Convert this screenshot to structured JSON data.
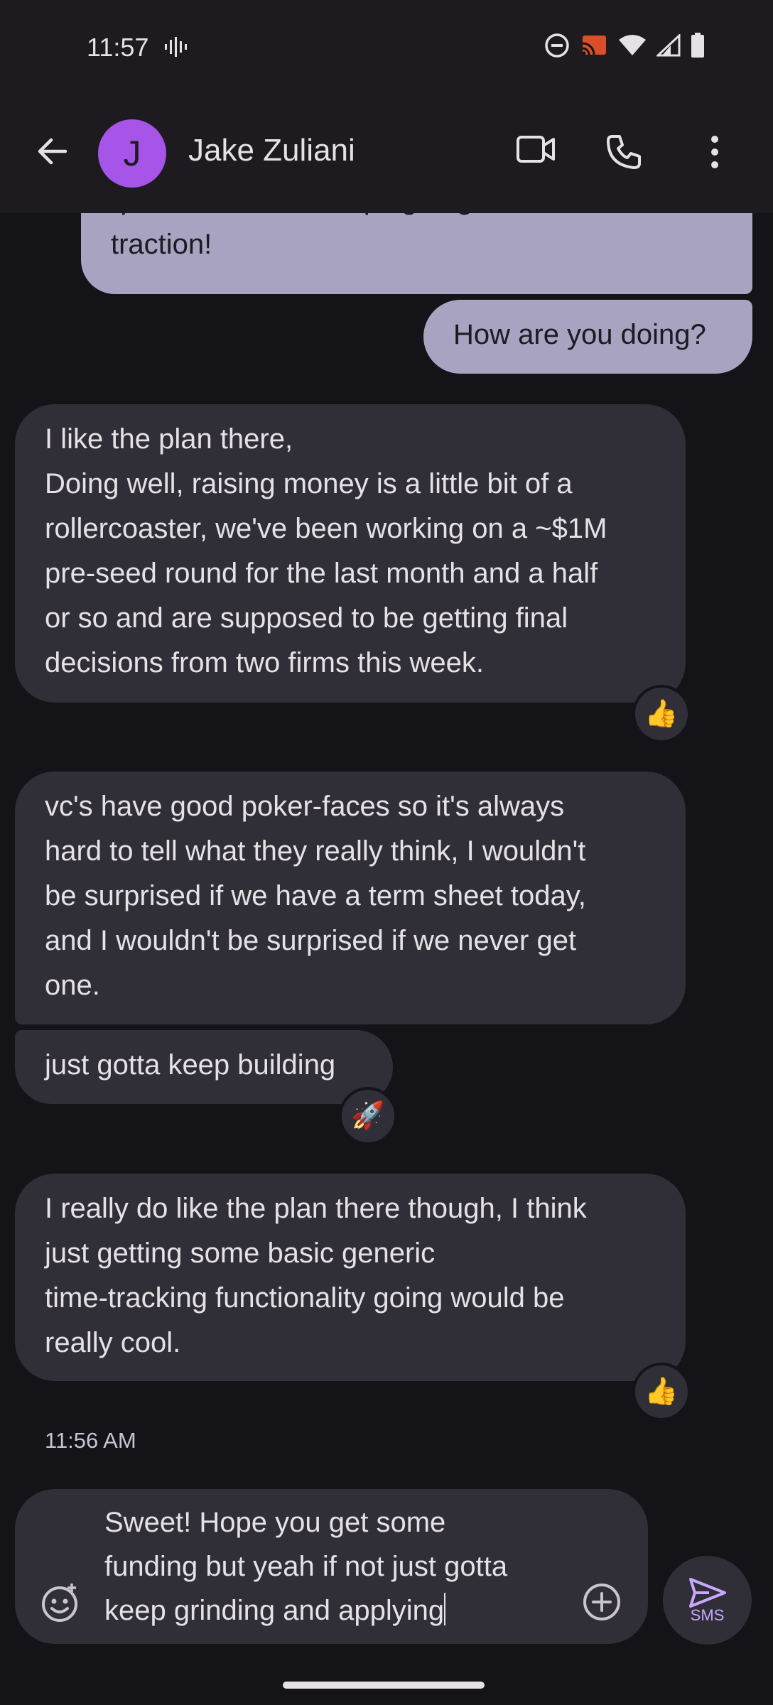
{
  "status": {
    "time": "11:57"
  },
  "header": {
    "avatar_letter": "J",
    "contact_name": "Jake Zuliani"
  },
  "messages": [
    {
      "dir": "out",
      "text": "quantified self so hoping to get some\ntraction!"
    },
    {
      "dir": "out",
      "text": "How are you doing?"
    },
    {
      "dir": "in",
      "text": "I like the plan there,\nDoing well, raising money is a little bit of a\nrollercoaster, we've been working on a ~$1M\npre-seed round for the last month and a half\nor so and are supposed to be getting final\ndecisions from two firms this week.",
      "reaction": "👍"
    },
    {
      "dir": "in",
      "text": "vc's have good poker-faces so it's always\nhard to tell what they really think, I wouldn't\nbe surprised if we have a term sheet today,\nand I wouldn't be surprised if we never get\none."
    },
    {
      "dir": "in",
      "text": "just gotta keep building",
      "reaction": "🚀"
    },
    {
      "dir": "in",
      "text": "I really do like the plan there though, I think\njust getting some basic generic\ntime-tracking functionality going would be\nreally cool.",
      "reaction": "👍"
    }
  ],
  "timestamp": "11:56 AM",
  "compose": {
    "text": "Sweet! Hope you get some\nfunding but yeah if not just gotta\nkeep grinding and applying"
  },
  "send": {
    "label": "SMS"
  },
  "icons": {
    "status": [
      "voice-wave-icon",
      "do-not-disturb-icon",
      "cast-icon",
      "wifi-icon",
      "cell-signal-icon",
      "battery-icon"
    ],
    "header": [
      "back-arrow-icon",
      "video-call-icon",
      "phone-icon",
      "more-vert-icon"
    ],
    "compose": [
      "emoji-icon",
      "add-circle-icon",
      "send-icon"
    ]
  },
  "colors": {
    "avatar": "#a655e8",
    "outgoing_bubble": "#a8a3c0",
    "incoming_bubble": "#302f37",
    "send_accent": "#c9a7ff"
  }
}
